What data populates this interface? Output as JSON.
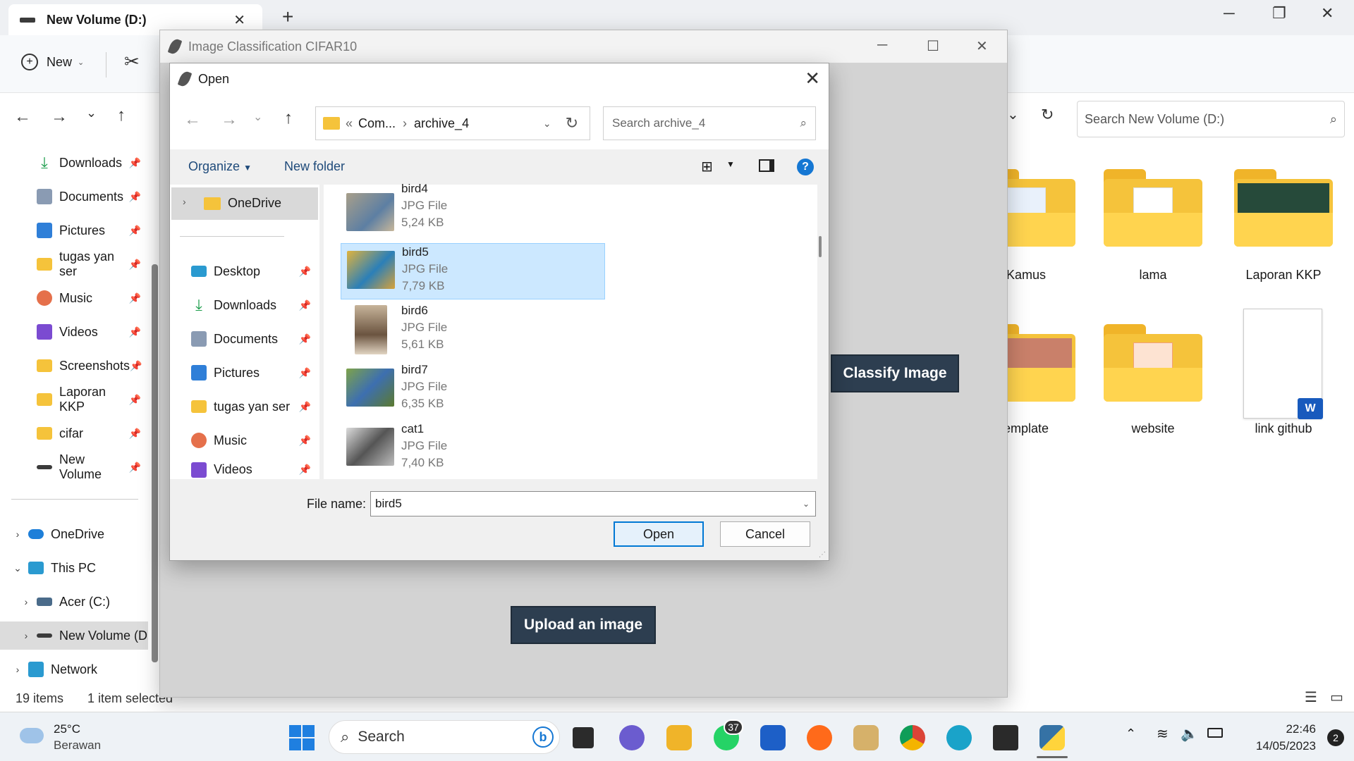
{
  "explorer": {
    "tab_title": "New Volume (D:)",
    "new_label": "New",
    "search_placeholder": "Search New Volume (D:)",
    "nav": {
      "quick": [
        {
          "label": "Downloads",
          "icon": "download-icon"
        },
        {
          "label": "Documents",
          "icon": "documents-icon"
        },
        {
          "label": "Pictures",
          "icon": "pictures-icon"
        },
        {
          "label": "tugas yan ser",
          "icon": "folder-icon"
        },
        {
          "label": "Music",
          "icon": "music-icon"
        },
        {
          "label": "Videos",
          "icon": "videos-icon"
        },
        {
          "label": "Screenshots",
          "icon": "folder-icon"
        },
        {
          "label": "Laporan KKP",
          "icon": "folder-icon"
        },
        {
          "label": "cifar",
          "icon": "folder-icon"
        },
        {
          "label": "New Volume",
          "icon": "drive-icon"
        }
      ],
      "tree": [
        {
          "label": "OneDrive",
          "icon": "onedrive-icon"
        },
        {
          "label": "This PC",
          "icon": "pc-icon"
        },
        {
          "label": "Acer (C:)",
          "icon": "drive-icon"
        },
        {
          "label": "New Volume (D",
          "icon": "drive-icon"
        },
        {
          "label": "Network",
          "icon": "network-icon"
        }
      ]
    },
    "items": [
      {
        "label": "Kamus"
      },
      {
        "label": "lama"
      },
      {
        "label": "Laporan KKP"
      },
      {
        "label": "emplate"
      },
      {
        "label": "website"
      },
      {
        "label": "link github"
      }
    ],
    "status": {
      "count": "19 items",
      "selected": "1 item selected"
    }
  },
  "app": {
    "title": "Image Classification CIFAR10",
    "classify_label": "Classify Image",
    "upload_label": "Upload an image"
  },
  "dialog": {
    "title": "Open",
    "breadcrumb": {
      "root": "Com...",
      "folder": "archive_4"
    },
    "search_placeholder": "Search archive_4",
    "organize_label": "Organize",
    "new_folder_label": "New folder",
    "left_nav": [
      {
        "label": "OneDrive",
        "icon": "folder-icon"
      },
      {
        "label": "Desktop",
        "icon": "desktop-icon"
      },
      {
        "label": "Downloads",
        "icon": "download-icon"
      },
      {
        "label": "Documents",
        "icon": "documents-icon"
      },
      {
        "label": "Pictures",
        "icon": "pictures-icon"
      },
      {
        "label": "tugas yan ser",
        "icon": "folder-icon"
      },
      {
        "label": "Music",
        "icon": "music-icon"
      },
      {
        "label": "Videos",
        "icon": "videos-icon"
      }
    ],
    "files": [
      {
        "name": "bird4",
        "type": "JPG File",
        "size": "5,24 KB"
      },
      {
        "name": "bird5",
        "type": "JPG File",
        "size": "7,79 KB"
      },
      {
        "name": "bird6",
        "type": "JPG File",
        "size": "5,61 KB"
      },
      {
        "name": "bird7",
        "type": "JPG File",
        "size": "6,35 KB"
      },
      {
        "name": "cat1",
        "type": "JPG File",
        "size": "7,40 KB"
      }
    ],
    "filename_label": "File name:",
    "filename_value": "bird5",
    "open_label": "Open",
    "cancel_label": "Cancel"
  },
  "taskbar": {
    "weather_temp": "25°C",
    "weather_desc": "Berawan",
    "search_label": "Search",
    "whatsapp_badge": "37",
    "time": "22:46",
    "date": "14/05/2023",
    "notifications": "2"
  }
}
